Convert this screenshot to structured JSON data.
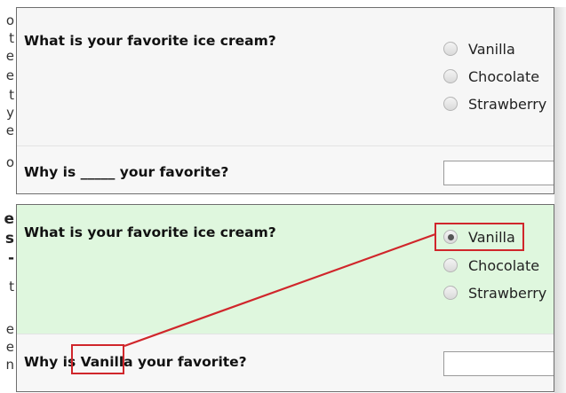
{
  "survey_blank": {
    "question1": "What is your favorite ice cream?",
    "options": [
      "Vanilla",
      "Chocolate",
      "Strawberry"
    ],
    "question2": "Why is _____ your favorite?"
  },
  "survey_filled": {
    "question1": "What is your favorite ice cream?",
    "options": [
      "Vanilla",
      "Chocolate",
      "Strawberry"
    ],
    "selected": "Vanilla",
    "question2_prefix": "Why is ",
    "question2_piped": "Vanilla",
    "question2_suffix": " your favorite?"
  },
  "colors": {
    "highlight": "#d0262b",
    "filled_bg": "#dff7de",
    "blank_bg": "#f6f6f6"
  }
}
